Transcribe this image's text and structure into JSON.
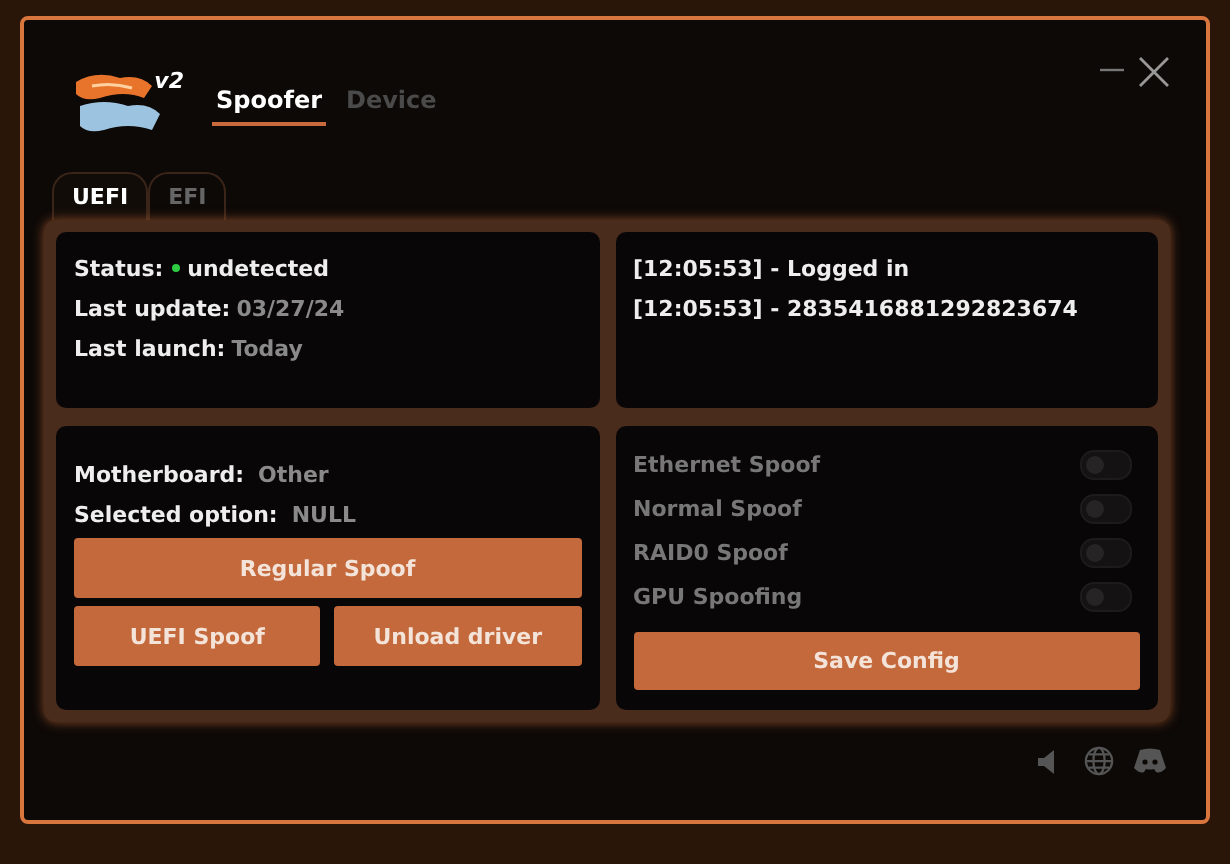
{
  "header": {
    "logo_badge": "v2",
    "tabs": [
      {
        "label": "Spoofer",
        "selected": true
      },
      {
        "label": "Device",
        "selected": false
      }
    ]
  },
  "subtabs": [
    {
      "label": "UEFI",
      "selected": true
    },
    {
      "label": "EFI",
      "selected": false
    }
  ],
  "info": [
    {
      "label": "Status:",
      "value": "undetected",
      "color": "#2ecc40"
    },
    {
      "label": "Last update:",
      "value": "03/27/24"
    },
    {
      "label": "Last launch:",
      "value": "Today"
    }
  ],
  "log": [
    "[12:05:53] - Logged in",
    "[12:05:53] - 2835416881292823674"
  ],
  "hardware": [
    {
      "label": "Motherboard:",
      "value": "Other"
    },
    {
      "label": "Selected option:",
      "value": "NULL"
    }
  ],
  "buttons": {
    "primary": "Regular Spoof",
    "secondary": [
      "UEFI Spoof",
      "Unload driver"
    ]
  },
  "options": [
    {
      "label": "Ethernet Spoof",
      "on": false
    },
    {
      "label": "Normal Spoof",
      "on": false
    },
    {
      "label": "RAID0 Spoof",
      "on": false
    },
    {
      "label": "GPU Spoofing",
      "on": false
    }
  ],
  "save_button": "Save Config"
}
